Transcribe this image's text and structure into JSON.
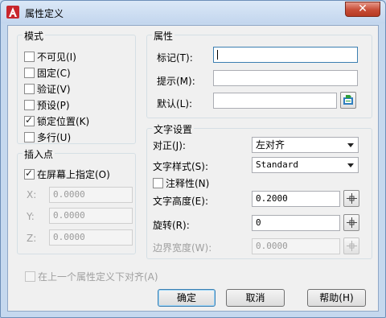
{
  "window": {
    "title": "属性定义",
    "close_label": "✕"
  },
  "mode": {
    "title": "模式",
    "options": [
      {
        "label": "不可见(I)",
        "checked": false
      },
      {
        "label": "固定(C)",
        "checked": false
      },
      {
        "label": "验证(V)",
        "checked": false
      },
      {
        "label": "预设(P)",
        "checked": false
      },
      {
        "label": "锁定位置(K)",
        "checked": true
      },
      {
        "label": "多行(U)",
        "checked": false
      }
    ]
  },
  "insertion_point": {
    "title": "插入点",
    "specify_on_screen": {
      "label": "在屏幕上指定(O)",
      "checked": true
    },
    "x": {
      "label": "X:",
      "value": "0.0000"
    },
    "y": {
      "label": "Y:",
      "value": "0.0000"
    },
    "z": {
      "label": "Z:",
      "value": "0.0000"
    }
  },
  "attribute": {
    "title": "属性",
    "tag": {
      "label": "标记(T):",
      "value": ""
    },
    "prompt": {
      "label": "提示(M):",
      "value": ""
    },
    "default": {
      "label": "默认(L):",
      "value": ""
    }
  },
  "text_settings": {
    "title": "文字设置",
    "justification": {
      "label": "对正(J):",
      "value": "左对齐"
    },
    "text_style": {
      "label": "文字样式(S):",
      "value": "Standard"
    },
    "annotative": {
      "label": "注释性(N)",
      "checked": false
    },
    "text_height": {
      "label": "文字高度(E):",
      "value": "0.2000"
    },
    "rotation": {
      "label": "旋转(R):",
      "value": "0"
    },
    "boundary_width": {
      "label": "边界宽度(W):",
      "value": "0.0000"
    }
  },
  "align_below": {
    "label": "在上一个属性定义下对齐(A)",
    "checked": false
  },
  "buttons": {
    "ok": "确定",
    "cancel": "取消",
    "help": "帮助(H)"
  },
  "colors": {
    "accent": "#3c7fb1",
    "close": "#c74c36",
    "icon_red": "#c8262d"
  },
  "icons": [
    "autocad-app-icon",
    "crosshair-pick-icon",
    "insert-field-icon"
  ]
}
